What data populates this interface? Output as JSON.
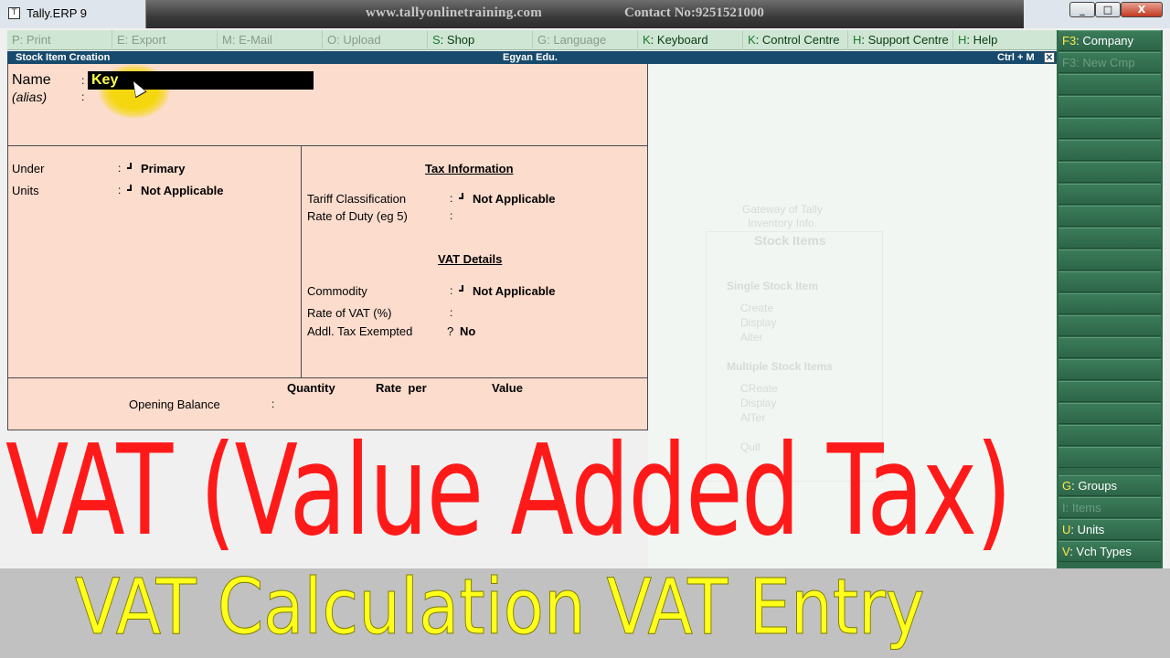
{
  "window": {
    "title": "Tally.ERP 9",
    "app_icon": "tally-app-icon",
    "url_text": "www.tallyonlinetraining.com",
    "contact_text": "Contact No:9251521000",
    "minimize": "_",
    "maximize": "□",
    "close": "X"
  },
  "menubar": [
    {
      "key": "P",
      "label": ": Print",
      "enabled": false
    },
    {
      "key": "E",
      "label": ": Export",
      "enabled": false
    },
    {
      "key": "M",
      "label": ": E-Mail",
      "enabled": false
    },
    {
      "key": "O",
      "label": ": Upload",
      "enabled": false
    },
    {
      "key": "S",
      "label": ": Shop",
      "enabled": true
    },
    {
      "key": "G",
      "label": ": Language",
      "enabled": false
    },
    {
      "key": "K",
      "label": ": Keyboard",
      "enabled": true
    },
    {
      "key": "K",
      "label": ": Control Centre",
      "enabled": true
    },
    {
      "key": "H",
      "label": ": Support Centre",
      "enabled": true
    },
    {
      "key": "H",
      "label": ": Help",
      "enabled": true
    }
  ],
  "screen": {
    "title": "Stock Item Creation",
    "company": "Egyan Edu.",
    "shortcut": "Ctrl + M",
    "close": "✕"
  },
  "form": {
    "name_label": "Name",
    "name_value": "Key",
    "alias_label": "(alias)",
    "colon": ":",
    "under_label": "Under",
    "under_value": "Primary",
    "units_label": "Units",
    "units_value": "Not Applicable",
    "tax_info_title": "Tax Information",
    "tariff_label": "Tariff Classification",
    "tariff_value": "Not Applicable",
    "rate_duty_label": "Rate of Duty (eg 5)",
    "vat_details_title": "VAT Details",
    "commodity_label": "Commodity",
    "commodity_value": "Not Applicable",
    "rate_vat_label": "Rate of VAT (%)",
    "addl_tax_label": "Addl. Tax Exempted",
    "addl_tax_sep": "?",
    "addl_tax_value": "No",
    "col_quantity": "Quantity",
    "col_rate": "Rate  per",
    "col_value": "Value",
    "opening_balance_label": "Opening Balance"
  },
  "right_panel": [
    {
      "key": "F3",
      "label": ": Company",
      "enabled": true
    },
    {
      "key": "F3",
      "label": ": New Cmp",
      "enabled": false
    },
    {
      "key": "G",
      "label": ": Groups",
      "enabled": true
    },
    {
      "key": "I",
      "label": ": Items",
      "enabled": false
    },
    {
      "key": "U",
      "label": ": Units",
      "enabled": true
    },
    {
      "key": "V",
      "label": ": Vch Types",
      "enabled": true
    }
  ],
  "background_ghost": {
    "gateway": "Gateway of Tally",
    "inventory": "Inventory Info.",
    "title": "Stock Items",
    "single": "Single Stock Item",
    "create": "Create",
    "display": "Display",
    "alter": "Alter",
    "multiple": "Multiple Stock Items",
    "create2": "CReate",
    "display2": "Display",
    "alter2": "AlTer",
    "quit": "Quit"
  },
  "overlay": {
    "headline": "VAT (Value Added Tax)",
    "subline": "VAT Calculation VAT Entry"
  },
  "colors": {
    "form_bg": "#fbdccd",
    "header_bg": "#174a6c",
    "menu_bg": "#cfe6d4",
    "right_panel_bg": "#2f6b4c",
    "headline": "#ff1a1a",
    "subline": "#ffff1a"
  }
}
